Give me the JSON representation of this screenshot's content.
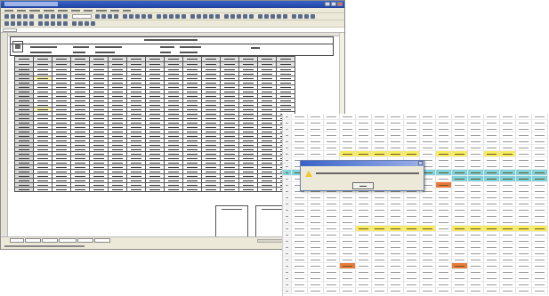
{
  "colors": {
    "title_bar": "#1e43a3",
    "chrome": "#ece9d8",
    "grid_line": "#555555",
    "highlight_yellow": "#f8ec5e",
    "highlight_orange": "#ea7a3a",
    "highlight_cyan": "#7fd3dc",
    "pale_yellow": "#fbf5b8"
  },
  "spreadsheet_window": {
    "icons": [
      "excel-app-icon",
      "minimize-icon",
      "maximize-icon",
      "close-icon"
    ],
    "menu_item_count": 10,
    "toolbar_rows": 2,
    "data_table": {
      "rows": 30,
      "columns": 15,
      "header_rows": 2
    },
    "signature_boxes": 2,
    "sheet_tabs": 6
  },
  "zoomed_grid": {
    "rows": 29,
    "columns": 17,
    "highlight_colors": [
      "yellow",
      "orange",
      "cyan"
    ]
  },
  "dialog": {
    "icon": "warning-icon",
    "buttons": [
      "ok-button"
    ]
  }
}
